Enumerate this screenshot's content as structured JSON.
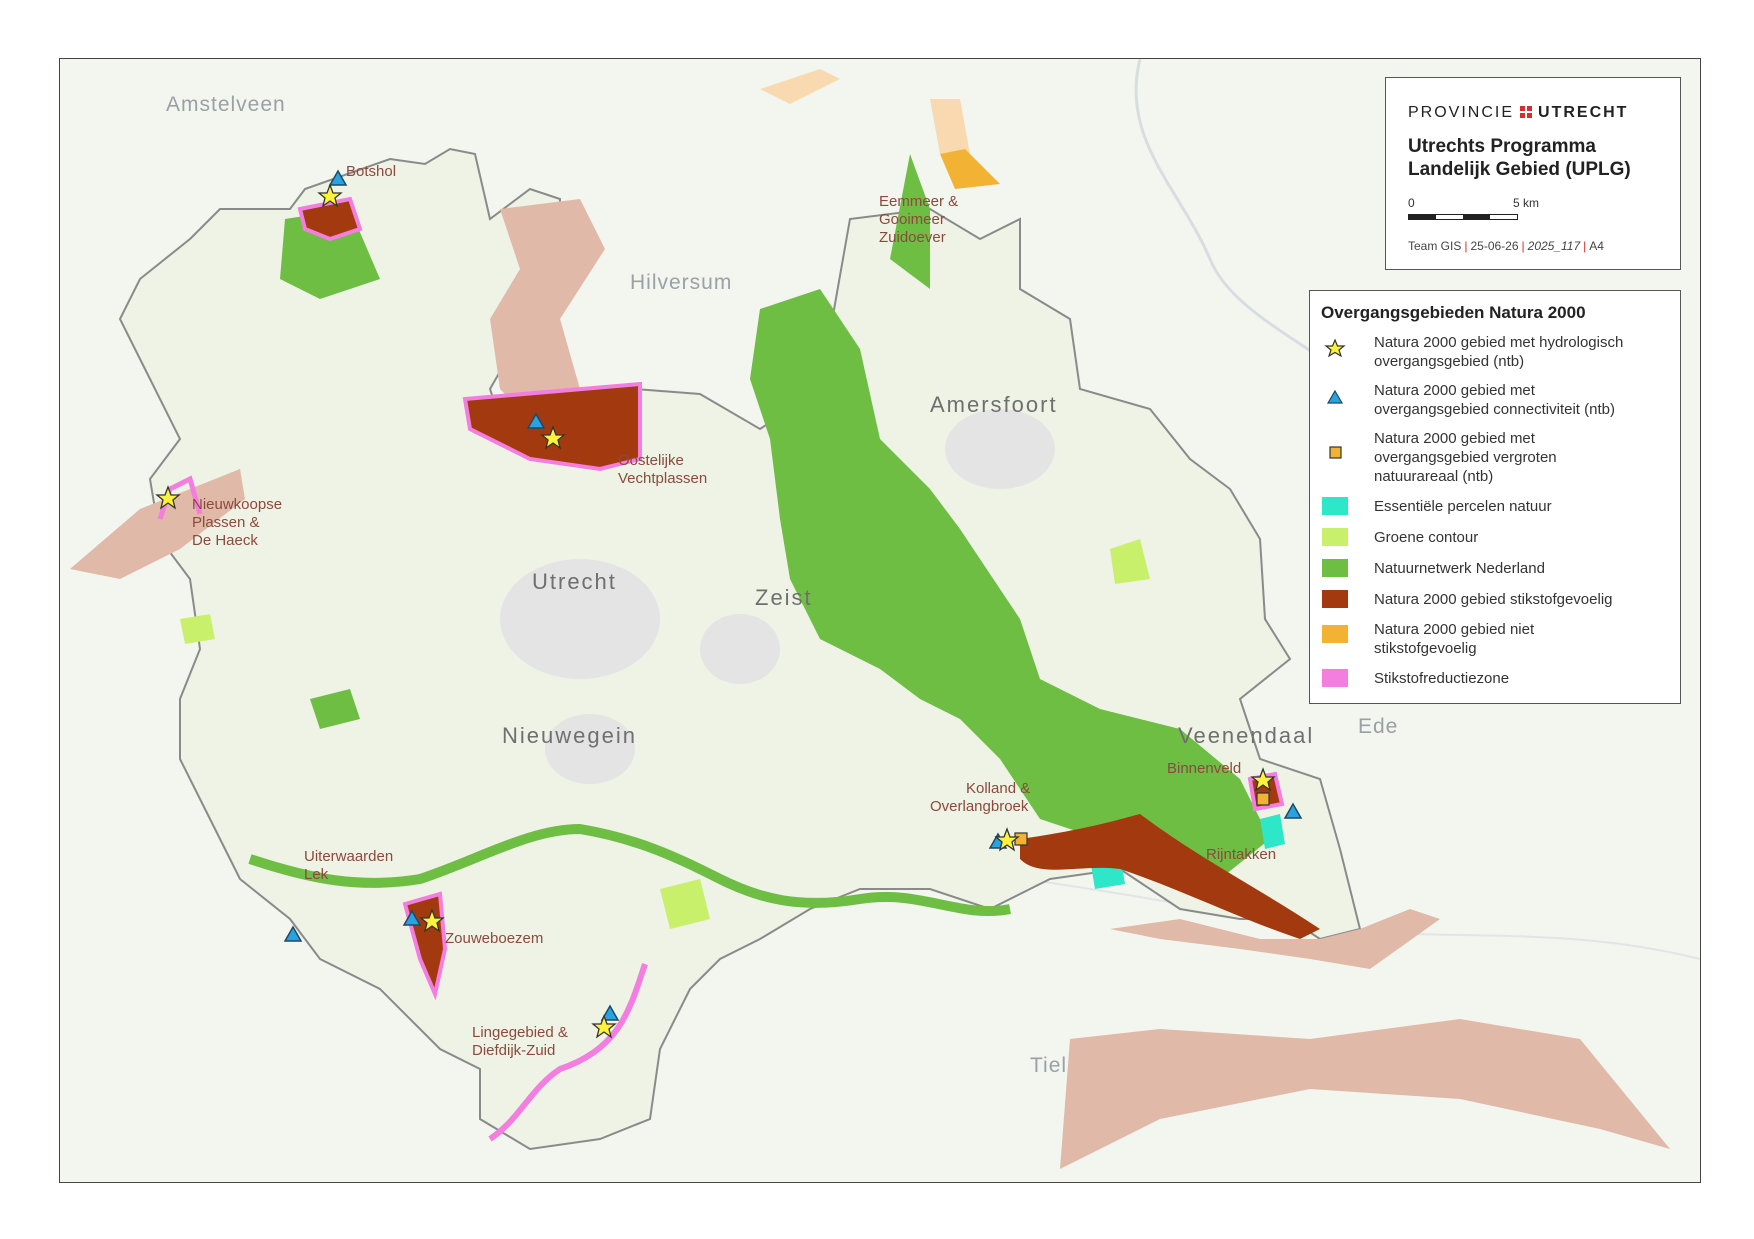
{
  "map": {
    "place_labels": [
      "Amstelveen",
      "Hilversum",
      "Ede",
      "Tiel"
    ],
    "city_labels": [
      "Amersfoort",
      "Utrecht",
      "Zeist",
      "Nieuwegein",
      "Veenendaal"
    ],
    "areas": [
      {
        "lines": [
          "Botshol"
        ]
      },
      {
        "lines": [
          "Eemmeer &",
          "Gooimeer",
          "Zuidoever"
        ]
      },
      {
        "lines": [
          "Oostelijke",
          "Vechtplassen"
        ]
      },
      {
        "lines": [
          "Nieuwkoopse",
          "Plassen &",
          "De Haeck"
        ]
      },
      {
        "lines": [
          "Kolland &",
          "Overlangbroek"
        ]
      },
      {
        "lines": [
          "Binnenveld"
        ]
      },
      {
        "lines": [
          "Rijntakken"
        ]
      },
      {
        "lines": [
          "Uiterwaarden",
          "Lek"
        ]
      },
      {
        "lines": [
          "Zouweboezem"
        ]
      },
      {
        "lines": [
          "Lingegebied &",
          "Diefdijk-Zuid"
        ]
      }
    ],
    "colors": {
      "background": "#f3f5ef",
      "province": "#eef3e6",
      "natuurnetwerk": "#6fbe44",
      "groene_contour": "#c9f06b",
      "essentiele_percelen": "#2ee6c8",
      "n2000_stikstof": "#a33a0f",
      "n2000_niet_stikstof": "#f2b334",
      "stikstofreductiezone": "#f47de0",
      "outside_n2000": "#e0b9a8",
      "water": "#d5e8f0",
      "urban": "#e4e4e4"
    }
  },
  "title_box": {
    "brand_left": "PROVINCIE",
    "brand_right": "UTRECHT",
    "title_lines": [
      "Utrechts Programma",
      "Landelijk Gebied (UPLG)"
    ],
    "scale_start": "0",
    "scale_end": "5 km",
    "credits": {
      "team": "Team GIS",
      "date": "25-06-26",
      "code": "2025_117",
      "format": "A4"
    }
  },
  "legend": {
    "title": "Overgangsgebieden Natura 2000",
    "items": [
      {
        "symbol": "star-icon",
        "color": "#fff23a",
        "lines": [
          "Natura 2000 gebied met hydrologisch",
          "overgangsgebied (ntb)"
        ]
      },
      {
        "symbol": "triangle-icon",
        "color": "#29a3e0",
        "lines": [
          "Natura 2000 gebied met",
          "overgangsgebied connectiviteit (ntb)"
        ]
      },
      {
        "symbol": "square-icon",
        "color": "#f2b334",
        "lines": [
          "Natura 2000 gebied met",
          "overgangsgebied vergroten",
          "natuurareaal (ntb)"
        ]
      },
      {
        "symbol": "patch",
        "color": "#2ee6c8",
        "lines": [
          "Essentiële percelen natuur"
        ]
      },
      {
        "symbol": "patch",
        "color": "#c9f06b",
        "lines": [
          "Groene contour"
        ]
      },
      {
        "symbol": "patch",
        "color": "#6fbe44",
        "lines": [
          "Natuurnetwerk Nederland"
        ]
      },
      {
        "symbol": "patch",
        "color": "#a33a0f",
        "lines": [
          "Natura 2000 gebied stikstofgevoelig"
        ]
      },
      {
        "symbol": "patch",
        "color": "#f2b334",
        "lines": [
          "Natura 2000 gebied niet",
          "stikstofgevoelig"
        ]
      },
      {
        "symbol": "patch",
        "color": "#f47de0",
        "lines": [
          "Stikstofreductiezone"
        ]
      }
    ]
  }
}
